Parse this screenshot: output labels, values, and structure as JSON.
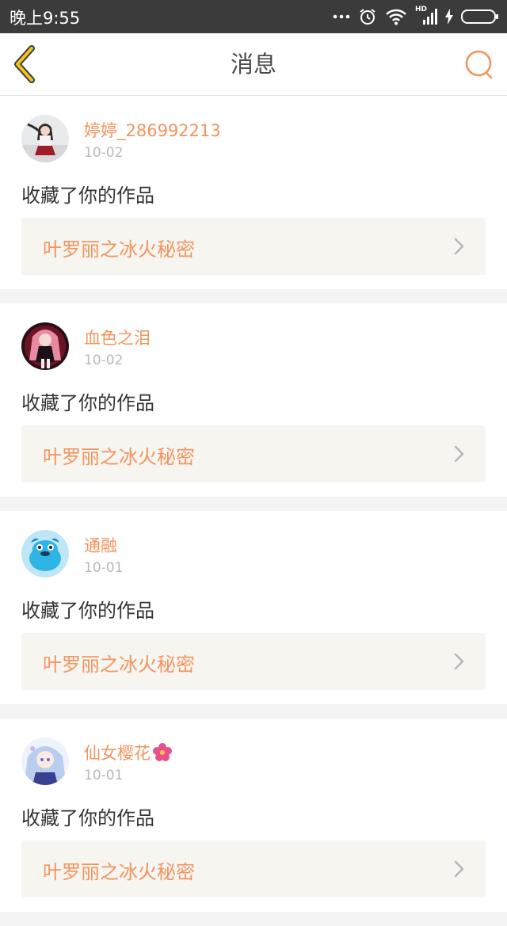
{
  "status_bar": {
    "time": "晚上9:55",
    "network_label": "HD"
  },
  "nav": {
    "title": "消息"
  },
  "messages": [
    {
      "username": "婷婷_286992213",
      "date": "10-02",
      "action": "收藏了你的作品",
      "work_title": "叶罗丽之冰火秘密",
      "avatar": "avatar-girl-red-skirt"
    },
    {
      "username": "血色之泪",
      "date": "10-02",
      "action": "收藏了你的作品",
      "work_title": "叶罗丽之冰火秘密",
      "avatar": "avatar-anime-pink-hair"
    },
    {
      "username": "通融",
      "date": "10-01",
      "action": "收藏了你的作品",
      "work_title": "叶罗丽之冰火秘密",
      "avatar": "avatar-blue-cartoon-creature"
    },
    {
      "username": "仙女樱花",
      "date": "10-01",
      "action": "收藏了你的作品",
      "work_title": "叶罗丽之冰火秘密",
      "avatar": "avatar-anime-blue-hair",
      "username_badge": "sakura-flower-icon"
    }
  ],
  "colors": {
    "accent": "#f2945e",
    "back_arrow": "#f3c21b",
    "status_bar": "#3b3b3b",
    "link_bg": "#f6f5f0"
  }
}
